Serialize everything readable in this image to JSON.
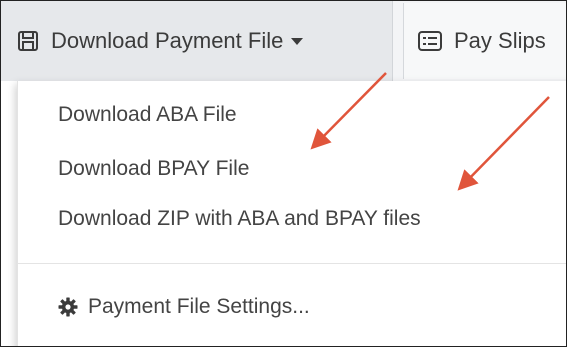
{
  "toolbar": {
    "download_label": "Download Payment File",
    "download_icon": "save-icon",
    "payslips_label": "Pay Slips",
    "payslips_icon": "list-icon"
  },
  "menu": {
    "items": [
      {
        "label": "Download ABA File"
      },
      {
        "label": "Download BPAY File"
      },
      {
        "label": "Download ZIP with ABA and BPAY files"
      }
    ],
    "settings_label": "Payment File Settings...",
    "settings_icon": "gear-icon"
  },
  "colors": {
    "arrow": "#e0553b",
    "toolbar_active": "#e6e8eb"
  }
}
